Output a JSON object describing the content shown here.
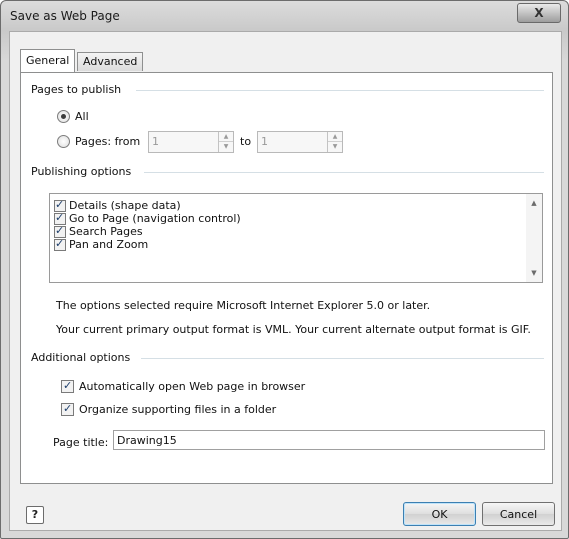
{
  "window": {
    "title": "Save as Web Page",
    "close_glyph": "X"
  },
  "tabs": [
    {
      "label": "General",
      "active": true
    },
    {
      "label": "Advanced",
      "active": false
    }
  ],
  "pages_to_publish": {
    "header": "Pages to publish",
    "all_label": "All",
    "all_selected": true,
    "pages_label": "Pages: from",
    "from_value": "1",
    "to_label": "to",
    "to_value": "1"
  },
  "publishing_options": {
    "header": "Publishing options",
    "items": [
      {
        "label": "Details (shape data)",
        "checked": true
      },
      {
        "label": "Go to Page (navigation control)",
        "checked": true
      },
      {
        "label": "Search Pages",
        "checked": true
      },
      {
        "label": "Pan and Zoom",
        "checked": true
      }
    ],
    "note1": "The options selected require Microsoft Internet Explorer 5.0 or later.",
    "note2": "Your current primary output format is VML. Your current alternate output format is GIF."
  },
  "additional_options": {
    "header": "Additional options",
    "auto_open_label": "Automatically open Web page in browser",
    "auto_open_checked": true,
    "organize_label": "Organize supporting files in a folder",
    "organize_checked": true,
    "page_title_label": "Page title:",
    "page_title_value": "Drawing15"
  },
  "footer": {
    "help_glyph": "?",
    "ok_label": "OK",
    "cancel_label": "Cancel"
  }
}
